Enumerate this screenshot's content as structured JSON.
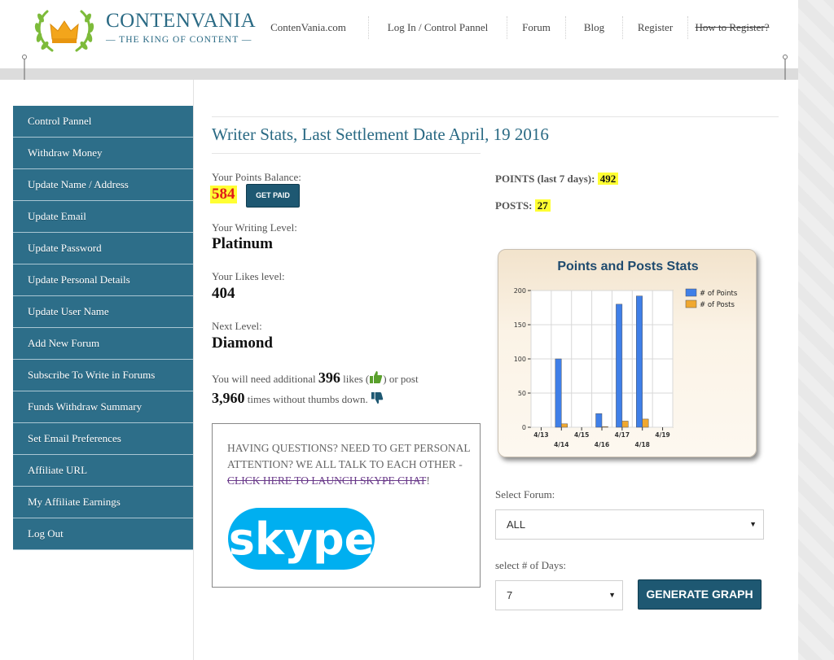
{
  "brand": {
    "name": "CONTENVANIA",
    "tagline": "— THE KING OF CONTENT —"
  },
  "nav": [
    {
      "label": "ContenVania.com",
      "strike": false
    },
    {
      "label": "Log In / Control Pannel",
      "strike": false
    },
    {
      "label": "Forum",
      "strike": false
    },
    {
      "label": "Blog",
      "strike": false
    },
    {
      "label": "Register",
      "strike": false
    },
    {
      "label": "How to Register?",
      "strike": true
    }
  ],
  "sidebar": {
    "items": [
      "Control Pannel",
      "Withdraw Money",
      "Update Name / Address",
      "Update Email",
      "Update Password",
      "Update Personal Details",
      "Update User Name",
      "Add New Forum",
      "Subscribe To Write in Forums",
      "Funds Withdraw Summary",
      "Set Email Preferences",
      "Affiliate URL",
      "My Affiliate Earnings",
      "Log Out"
    ]
  },
  "main": {
    "title": "Writer Stats, Last Settlement Date April, 19 2016",
    "points_balance_label": "Your Points Balance:",
    "points_balance_value": "584",
    "get_paid_label": "GET PAID",
    "writing_level_label": "Your Writing Level:",
    "writing_level_value": "Platinum",
    "likes_level_label": "Your Likes level:",
    "likes_level_value": "404",
    "next_level_label": "Next Level:",
    "next_level_value": "Diamond",
    "need_prefix": "You will need additional",
    "need_likes": "396",
    "need_mid": "likes (",
    "need_mid2": ") or post",
    "need_posts": "3,960",
    "need_suffix": "times without thumbs down.",
    "skype_text": "HAVING QUESTIONS? NEED TO GET PERSONAL ATTENTION? WE ALL TALK TO EACH OTHER -",
    "skype_link": "CLICK HERE TO LAUNCH SKYPE CHAT",
    "skype_end": "!",
    "skype_logo_text": "skype"
  },
  "stats": {
    "points_label": "POINTS (last 7 days):",
    "points_value": "492",
    "posts_label": "POSTS:",
    "posts_value": "27"
  },
  "chart_data": {
    "type": "bar",
    "title": "Points and Posts Stats",
    "categories": [
      "4/13",
      "4/14",
      "4/15",
      "4/16",
      "4/17",
      "4/18",
      "4/19"
    ],
    "series": [
      {
        "name": "# of Points",
        "values": [
          0,
          100,
          0,
          20,
          180,
          192,
          0
        ],
        "color": "#3f7fe8"
      },
      {
        "name": "# of Posts",
        "values": [
          0,
          5,
          0,
          1,
          9,
          12,
          0
        ],
        "color": "#f0a830"
      }
    ],
    "ylim": [
      0,
      200
    ],
    "yticks": [
      0,
      50,
      100,
      150,
      200
    ],
    "grid": true,
    "legend": "top-right"
  },
  "form": {
    "forum_label": "Select Forum:",
    "forum_value": "ALL",
    "days_label": "select # of Days:",
    "days_value": "7",
    "generate_label": "GENERATE GRAPH"
  },
  "colors": {
    "accent": "#2d6e89",
    "button": "#1e5872",
    "highlight": "#ffff33",
    "balance": "#e01a1a"
  }
}
